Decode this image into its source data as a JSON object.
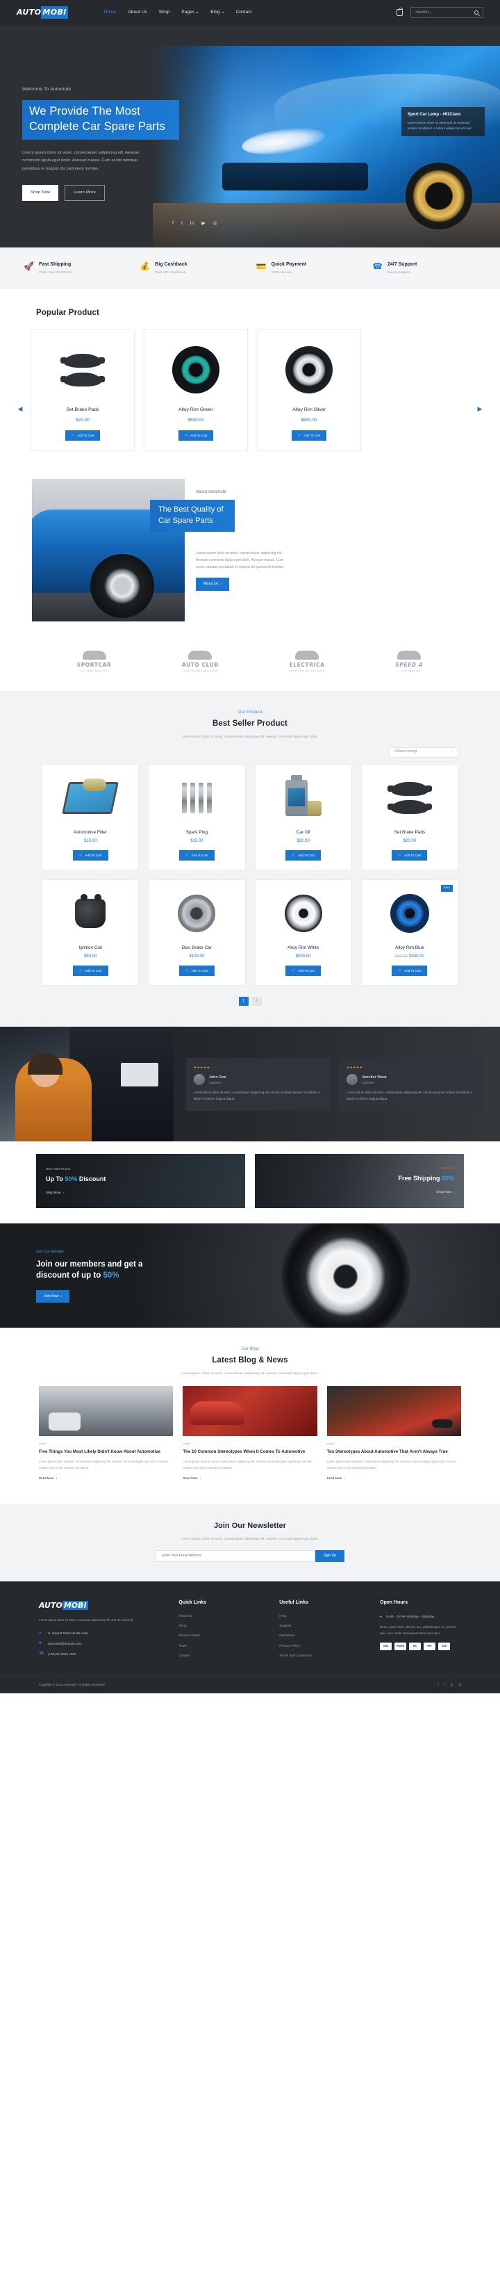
{
  "header": {
    "logo_main": "AUTO",
    "logo_accent": "MOBI",
    "nav": [
      {
        "label": "Home",
        "active": true,
        "caret": false
      },
      {
        "label": "About Us",
        "active": false,
        "caret": false
      },
      {
        "label": "Shop",
        "active": false,
        "caret": false
      },
      {
        "label": "Pages",
        "active": false,
        "caret": true
      },
      {
        "label": "Blog",
        "active": false,
        "caret": true
      },
      {
        "label": "Contact",
        "active": false,
        "caret": false
      }
    ],
    "cart_icon": "shopping-bag-icon",
    "search_placeholder": "Search...",
    "search_value": ""
  },
  "hero": {
    "welcome": "Welcome To Automobi",
    "title_line1": "We Provide The Most",
    "title_line2": "Complete Car Spare Parts",
    "paragraph": "Lorem ipsum dolor sit amet, consectetuer adipiscing elit. Aenean commodo ligula eget dolor. Aenean massa. Cum sociis natoque penatibus et magnis dis parturient montes.",
    "btn_primary": "Shop Now",
    "btn_secondary": "Learn More",
    "social": [
      "f",
      "t",
      "in",
      "▶",
      "◎"
    ],
    "badge_title": "Sport Car Lamp - #91Class",
    "badge_text": "Lorem ipsum dolor sit amet sed do eiusmod tempor incididunt ut labore adipiscing elit sed."
  },
  "services": [
    {
      "icon": "rocket-icon",
      "title": "Fast Shipping",
      "sub": "Order Over $1.000.00"
    },
    {
      "icon": "cashback-icon",
      "title": "Big Cashback",
      "sub": "Over 40% Cashback"
    },
    {
      "icon": "payment-icon",
      "title": "Quick Payment",
      "sub": "100% Secure"
    },
    {
      "icon": "support-icon",
      "title": "24/7 Support",
      "sub": "Ready Support"
    }
  ],
  "popular": {
    "title": "Popular Product",
    "prev_icon": "chevron-left-icon",
    "next_icon": "chevron-right-icon",
    "add_to_cart": "Add To Cart",
    "items": [
      {
        "name": "Set Brake Pads",
        "price": "$20.00",
        "img": "brake-pads"
      },
      {
        "name": "Alloy Rim Green",
        "price": "$500.00",
        "img": "rim-green"
      },
      {
        "name": "Alloy Rim Silver",
        "price": "$500.00",
        "img": "rim-silver"
      }
    ]
  },
  "about": {
    "kicker": "About Automobi",
    "title_line1": "The Best Quality of",
    "title_line2": "Car Spare Parts",
    "paragraph": "Lorem ipsum dolor sit amet, consectetuer adipiscing elit. Aenean commodo ligula eget dolor. Aenean massa. Cum sociis natoque penatibus et magnis dis parturient montes.",
    "button": "About Us"
  },
  "brands": [
    {
      "name": "SPORTCAR",
      "sub": "FACTORY SERVICE",
      "italic": false
    },
    {
      "name": "AUTO CLUB",
      "sub": "YOUR DEALER AND CARE",
      "italic": false
    },
    {
      "name": "ELECTRICA",
      "sub": "YOUR DEALER AND CARE",
      "italic": false
    },
    {
      "name": "SPEED A",
      "sub": "— CAR SERVICE",
      "italic": true
    }
  ],
  "best": {
    "kicker": "Our Product",
    "title": "Best Seller Product",
    "sub": "Lorem ipsum dolor sit amet, consectetuer adipiscing elit. Aenean commodo ligula eget dolor.",
    "sort_value": "Default sorting",
    "sort_icon": "chevron-down-icon",
    "add_to_cart": "Add To Cart",
    "sale_label": "SALE",
    "items": [
      {
        "name": "Automotive Filter",
        "price": "$15.00",
        "old": "",
        "sale": false,
        "img": "filter"
      },
      {
        "name": "Spark Plug",
        "price": "$15.00",
        "old": "",
        "sale": false,
        "img": "plug"
      },
      {
        "name": "Car Oil",
        "price": "$20.00",
        "old": "",
        "sale": false,
        "img": "oil"
      },
      {
        "name": "Set Brake Pads",
        "price": "$20.00",
        "old": "",
        "sale": false,
        "img": "brake"
      },
      {
        "name": "Ignition Coil",
        "price": "$50.00",
        "old": "",
        "sale": false,
        "img": "coil"
      },
      {
        "name": "Disc Brake Car",
        "price": "$100.00",
        "old": "",
        "sale": false,
        "img": "disc"
      },
      {
        "name": "Alloy Rim White",
        "price": "$500.00",
        "old": "",
        "sale": false,
        "img": "rimwhite"
      },
      {
        "name": "Alloy Rim Blue",
        "price": "$300.00",
        "old": "$500.00",
        "sale": true,
        "img": "rimblue"
      }
    ],
    "pages": [
      "1",
      "2"
    ]
  },
  "testimonials": [
    {
      "stars": "★★★★★",
      "name": "John Doe",
      "role": "Customer",
      "text": "Lorem ipsum dolor sit amet, consectetuer adipiscing elit, sed do eiusmod tempor incididunt ut labore et dolore magna aliqua."
    },
    {
      "stars": "★★★★★",
      "name": "Jennifer West",
      "role": "Customer",
      "text": "Lorem ipsum dolor sit amet, consectetuer adipiscing elit, sed do eiusmod tempor incididunt ut labore et dolore magna aliqua."
    }
  ],
  "promos": [
    {
      "kicker": "New Years Promo",
      "title_pre": "Up To ",
      "title_hi": "50%",
      "title_post": " Discount",
      "button": "Shop Now"
    },
    {
      "kicker": "Best Deal",
      "title_pre": "Free Shipping ",
      "title_hi": "80%",
      "title_post": "",
      "button": "Shop Now"
    }
  ],
  "member": {
    "kicker": "Join Our Member",
    "title_pre": "Join our members and get a",
    "title_mid": "discount of up to ",
    "title_hi": "50%",
    "button": "Join Now"
  },
  "blog": {
    "kicker": "Our Blog",
    "title": "Latest Blog & News",
    "sub": "Lorem ipsum dolor sit amet, consectetuer adipiscing elit. Aenean commodo ligula eget dolor.",
    "read_more": "Read More",
    "posts": [
      {
        "meta": "Linda",
        "title": "Five Things You Most Likely Didn't Know About Automotive",
        "excerpt": "Lorem ipsum dolor sit amet, consectetuer adipiscing elit. Aenean commodo ligula eget dolor. Aenean massa. Cum sociis natoque penatibus."
      },
      {
        "meta": "Linda",
        "title": "The 10 Common Stereotypes When It Comes To Automotive",
        "excerpt": "Lorem ipsum dolor sit amet, consectetuer adipiscing elit. Aenean commodo ligula eget dolor. Aenean massa. Cum sociis natoque penatibus."
      },
      {
        "meta": "Linda",
        "title": "Ten Stereotypes About Automotive That Aren't Always True",
        "excerpt": "Lorem ipsum dolor sit amet, consectetuer adipiscing elit. Aenean commodo ligula eget dolor. Aenean massa. Cum sociis natoque penatibus."
      }
    ]
  },
  "newsletter": {
    "title": "Join Our Newsletter",
    "sub": "Lorem ipsum dolor sit amet, consectetuer adipiscing elit. Aenean commodo ligula eget dolor.",
    "placeholder": "Enter Your Email Address",
    "button": "Sign Up"
  },
  "footer": {
    "logo_main": "AUTO",
    "logo_accent": "MOBI",
    "desc": "Lorem ipsum dolor sit amet, consectet adipiscing elit, sed do eiusmod.",
    "address": "Jl. Sunset Road No.99, Kuta",
    "email": "automobi@domain.com",
    "phone": "(+62) 81 2345 1234",
    "quick_links_title": "Quick Links",
    "quick_links": [
      "About Us",
      "Shop",
      "Product Detail",
      "Team",
      "Contact"
    ],
    "useful_links_title": "Useful Links",
    "useful_links": [
      "FAQ",
      "Support",
      "Disclaimer",
      "Privacy Policy",
      "Terms and Conditions"
    ],
    "hours_title": "Open Hours",
    "hours": "9 AM - 10 PM, Monday - Saturday",
    "hours_note": "Donec quam felis, ultricies nec, pellentesque eu, pretium quis, sem. Nulla consequat massa quis enim.",
    "payments": [
      "VISA",
      "PayPal",
      "MC",
      "PAY",
      "JCB"
    ],
    "copyright": "Copyright © 2022 Automobi. All Rights Reserved.",
    "social": [
      "f",
      "t",
      "in",
      "◎"
    ]
  },
  "colors": {
    "accent": "#1b76cf",
    "dark": "#26292d",
    "light": "#f2f3f4"
  }
}
